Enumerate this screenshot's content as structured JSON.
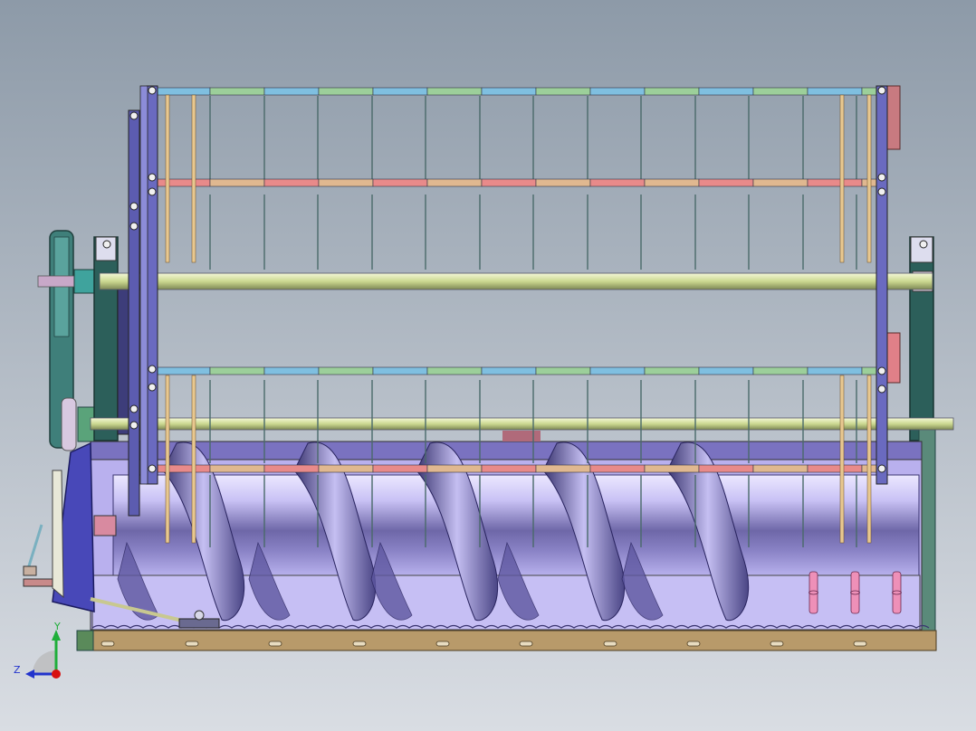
{
  "view": {
    "background_top": "#8d9aa8",
    "background_bottom": "#d9dde3"
  },
  "triad": {
    "y_label": "Y",
    "z_label": "Z",
    "y_color": "#1fae3a",
    "z_color": "#2233cc",
    "x_color": "#d81010"
  },
  "palette": {
    "upper_rail_blue": "#7fbfe0",
    "upper_rail_green": "#9ccf9a",
    "lower_rail_pink": "#e88a8a",
    "lower_rail_tan": "#e0b890",
    "shaft": "#d9e6a8",
    "frame_dark": "#2c5f5a",
    "link_purple": "#6a6ac0",
    "drum_light": "#c8c0f4",
    "drum_dark": "#5b5590",
    "base_plate": "#b89a6a",
    "tine": "#4a6a6a"
  }
}
